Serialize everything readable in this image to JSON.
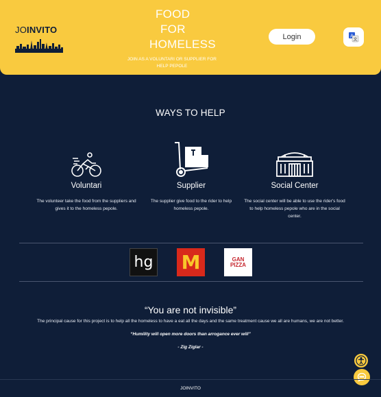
{
  "header": {
    "logo": {
      "prefix": "JO",
      "suffix": "INVITO"
    },
    "hero": {
      "line1": "FOOD",
      "line2": "FOR",
      "line3": "HOMELESS",
      "subtitle": "JOIN AS A VOLUNTARI OR SUPPLIER FOR HELP PEPOLE"
    },
    "login_label": "Login",
    "translate_icon": "translate-icon"
  },
  "ways": {
    "title": "WAYS TO HELP",
    "items": [
      {
        "name": "Voluntari",
        "icon": "cyclist-icon",
        "desc": "The volunteer take the food from the suppliers and gives it to the homeless pepole."
      },
      {
        "name": "Supplier",
        "icon": "hand-truck-icon",
        "desc": "The supplier give food to the rider to help homeless pepole."
      },
      {
        "name": "Social Center",
        "icon": "building-icon",
        "desc": "The social center will be able to use the rider's food to help homeless pepole who are in the social center."
      }
    ]
  },
  "brands": [
    {
      "name": "hg",
      "text": "hg"
    },
    {
      "name": "mcdonalds",
      "text": "M"
    },
    {
      "name": "gan-pizza",
      "line1": "GAN",
      "line2": "PIZZA"
    }
  ],
  "quote": {
    "title": "“You are not invisible”",
    "text": "The principal cause for this project is to help all the homeless to have a eat all the days and the same treatment cause we all are humans, we are not better.",
    "italic": "“Humility will open more doors than arrogance ever will”",
    "author": "- Zig Ziglar -"
  },
  "footer": {
    "text": "JOINVITO"
  },
  "colors": {
    "accent": "#f9ca3f",
    "background": "#0f1e38"
  }
}
